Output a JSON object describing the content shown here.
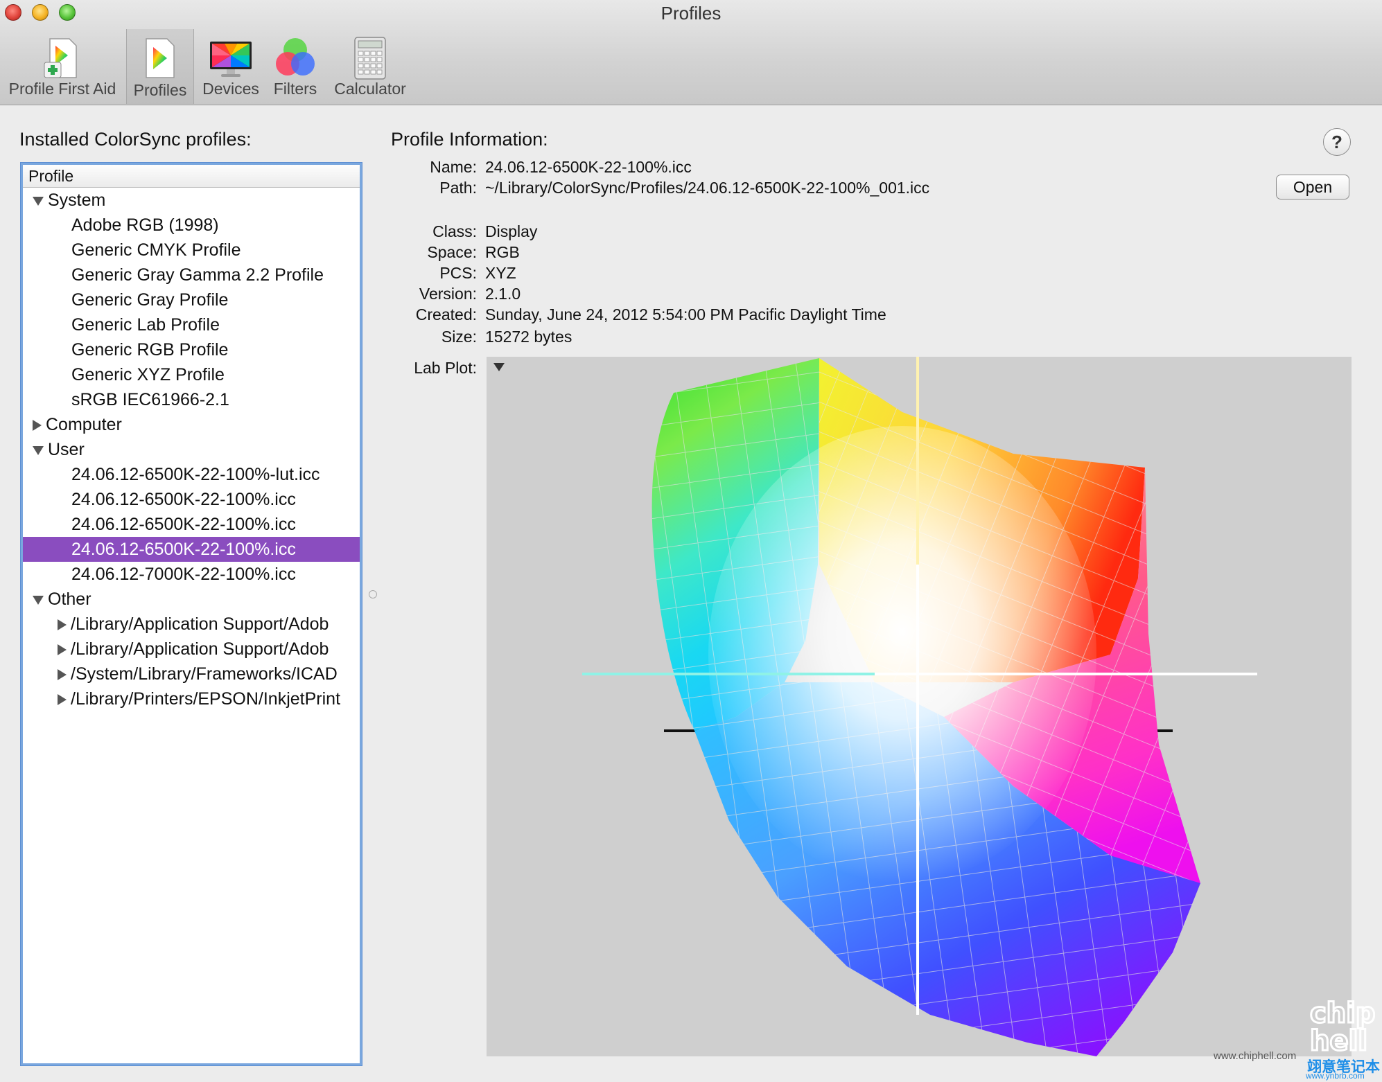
{
  "window": {
    "title": "Profiles"
  },
  "toolbar": {
    "items": [
      {
        "label": "Profile First Aid",
        "icon": "first-aid-icon"
      },
      {
        "label": "Profiles",
        "icon": "profiles-icon",
        "selected": true
      },
      {
        "label": "Devices",
        "icon": "display-icon"
      },
      {
        "label": "Filters",
        "icon": "filters-icon"
      },
      {
        "label": "Calculator",
        "icon": "calculator-icon"
      }
    ]
  },
  "sidebar": {
    "title": "Installed ColorSync profiles:",
    "column_header": "Profile",
    "groups": {
      "system": {
        "label": "System",
        "expanded": true,
        "items": [
          "Adobe RGB (1998)",
          "Generic CMYK Profile",
          "Generic Gray Gamma 2.2 Profile",
          "Generic Gray Profile",
          "Generic Lab Profile",
          "Generic RGB Profile",
          "Generic XYZ Profile",
          "sRGB IEC61966-2.1"
        ]
      },
      "computer": {
        "label": "Computer",
        "expanded": false
      },
      "user": {
        "label": "User",
        "expanded": true,
        "items": [
          "24.06.12-6500K-22-100%-lut.icc",
          "24.06.12-6500K-22-100%.icc",
          "24.06.12-6500K-22-100%.icc",
          "24.06.12-6500K-22-100%.icc",
          "24.06.12-7000K-22-100%.icc"
        ],
        "selected_index": 3
      },
      "other": {
        "label": "Other",
        "expanded": true,
        "items": [
          "/Library/Application Support/Adob",
          "/Library/Application Support/Adob",
          "/System/Library/Frameworks/ICAD",
          "/Library/Printers/EPSON/InkjetPrint"
        ]
      }
    },
    "selection_color": "#8a4dbf"
  },
  "info": {
    "title": "Profile Information:",
    "name_label": "Name:",
    "name": "24.06.12-6500K-22-100%.icc",
    "path_label": "Path:",
    "path": "~/Library/ColorSync/Profiles/24.06.12-6500K-22-100%_001.icc",
    "open_button": "Open",
    "help_button": "?",
    "class_label": "Class:",
    "class": "Display",
    "space_label": "Space:",
    "space": "RGB",
    "pcs_label": "PCS:",
    "pcs": "XYZ",
    "version_label": "Version:",
    "version": "2.1.0",
    "created_label": "Created:",
    "created": "Sunday, June 24, 2012 5:54:00 PM Pacific Daylight Time",
    "size_label": "Size:",
    "size": "15272 bytes",
    "lab_plot_label": "Lab Plot:"
  },
  "watermark": {
    "site1": "www.chiphell.com",
    "site2": "www.ynbrb.com",
    "brand": "翊意笔记本"
  }
}
